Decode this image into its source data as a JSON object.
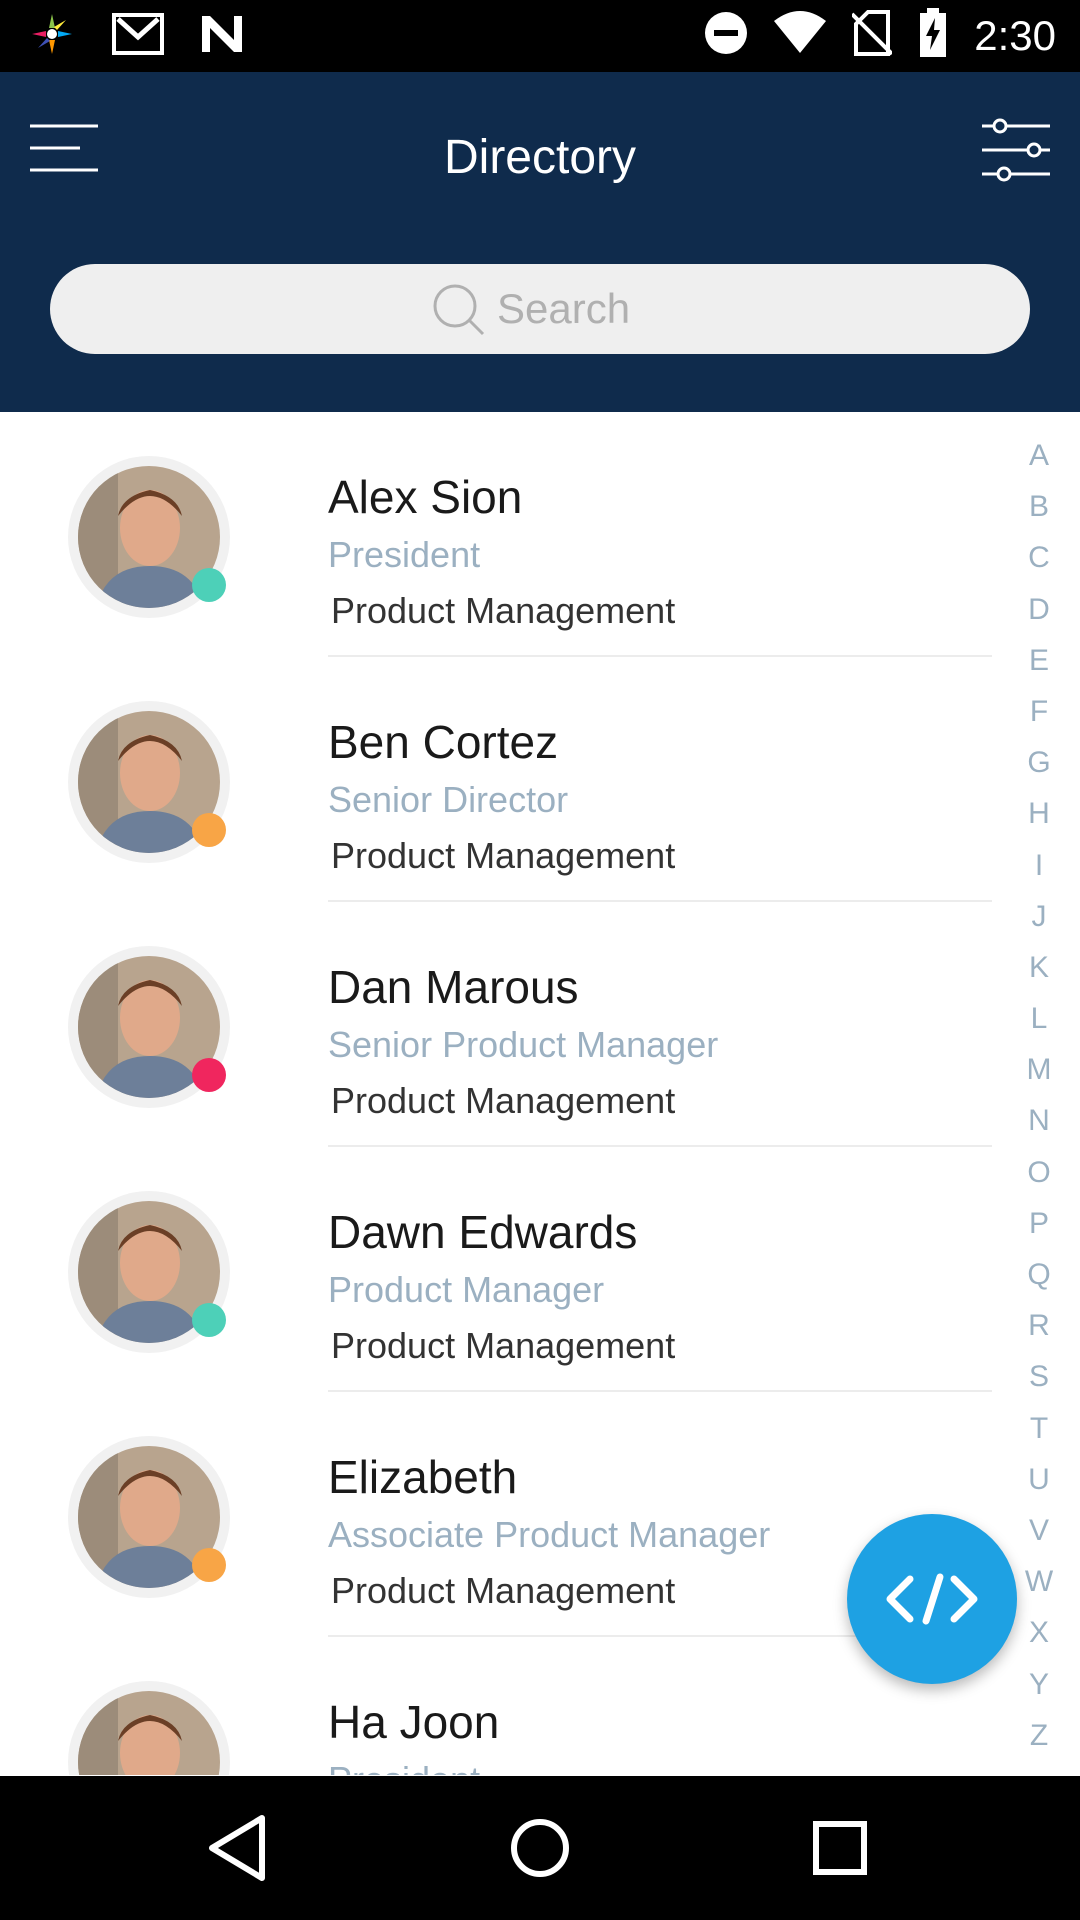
{
  "status_bar": {
    "time": "2:30",
    "left_icons": [
      "pinwheel-app-icon",
      "gmail-icon",
      "n-icon"
    ],
    "right_icons": [
      "do-not-disturb-icon",
      "wifi-icon",
      "no-sim-icon",
      "battery-charging-icon"
    ]
  },
  "header": {
    "title": "Directory",
    "menu_icon": "hamburger-menu-icon",
    "filter_icon": "filter-sliders-icon",
    "background": "#0f2b4c"
  },
  "search": {
    "placeholder": "Search",
    "icon": "search-icon"
  },
  "contacts": [
    {
      "name": "Alex Sion",
      "title": "President",
      "department": "Product Management",
      "status_color": "#4dd0b8"
    },
    {
      "name": "Ben Cortez",
      "title": "Senior Director",
      "department": "Product Management",
      "status_color": "#f8a546"
    },
    {
      "name": "Dan Marous",
      "title": "Senior Product Manager",
      "department": "Product Management",
      "status_color": "#f0265e"
    },
    {
      "name": "Dawn Edwards",
      "title": "Product Manager",
      "department": "Product Management",
      "status_color": "#4dd0b8"
    },
    {
      "name": "Elizabeth",
      "title": "Associate Product Manager",
      "department": "Product Management",
      "status_color": "#f8a546"
    },
    {
      "name": "Ha Joon",
      "title": "President",
      "department": "",
      "status_color": ""
    }
  ],
  "alphabet_index": [
    "A",
    "B",
    "C",
    "D",
    "E",
    "F",
    "G",
    "H",
    "I",
    "J",
    "K",
    "L",
    "M",
    "N",
    "O",
    "P",
    "Q",
    "R",
    "S",
    "T",
    "U",
    "V",
    "W",
    "X",
    "Y",
    "Z"
  ],
  "fab": {
    "icon": "code-icon",
    "color": "#1ea1e3"
  },
  "nav_bar": {
    "icons": [
      "back-icon",
      "home-icon",
      "recents-icon"
    ]
  }
}
